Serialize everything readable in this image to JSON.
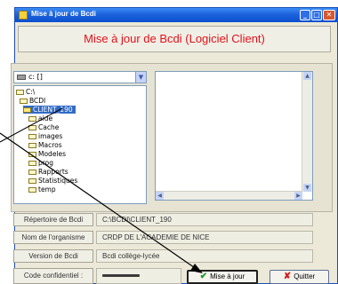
{
  "window": {
    "title": "Mise à jour de Bcdi",
    "controls": {
      "minimize": "_",
      "maximize": "□",
      "close": "✕"
    }
  },
  "banner": {
    "heading": "Mise à jour de Bcdi (Logiciel Client)"
  },
  "drive": {
    "selected": "c: []",
    "arrow": "▼"
  },
  "tree": {
    "items": [
      {
        "label": "C:\\",
        "icon": "folder-open-icon"
      },
      {
        "label": "BCDI",
        "icon": "folder-open-icon"
      },
      {
        "label": "CLIENT_190",
        "icon": "folder-open-icon",
        "selected": true
      },
      {
        "label": "aide",
        "icon": "folder-icon"
      },
      {
        "label": "Cache",
        "icon": "folder-icon"
      },
      {
        "label": "images",
        "icon": "folder-icon"
      },
      {
        "label": "Macros",
        "icon": "folder-icon"
      },
      {
        "label": "Modeles",
        "icon": "folder-icon"
      },
      {
        "label": "prog",
        "icon": "folder-icon"
      },
      {
        "label": "Rapports",
        "icon": "folder-icon"
      },
      {
        "label": "Statistiques",
        "icon": "folder-icon"
      },
      {
        "label": "temp",
        "icon": "folder-icon"
      }
    ]
  },
  "fields": {
    "directory": {
      "label": "Répertoire de Bcdi",
      "value": "C:\\BCDI\\CLIENT_190"
    },
    "organisation": {
      "label": "Nom de l'organisme",
      "value": "CRDP DE L'ACADEMIE DE NICE"
    },
    "version": {
      "label": "Version de Bcdi",
      "value": "Bcdi collège-lycée"
    },
    "code": {
      "label": "Code confidentiel :",
      "value": ""
    }
  },
  "buttons": {
    "update": {
      "label": "Mise à jour",
      "icon": "check-icon",
      "glyph": "✔"
    },
    "quit": {
      "label": "Quitter",
      "icon": "cross-icon",
      "glyph": "✘"
    }
  },
  "colors": {
    "title_bar": "#1d62dc",
    "heading": "#e2101a",
    "selection": "#316ac5",
    "check": "#1a9a22",
    "cross": "#d0201a"
  }
}
